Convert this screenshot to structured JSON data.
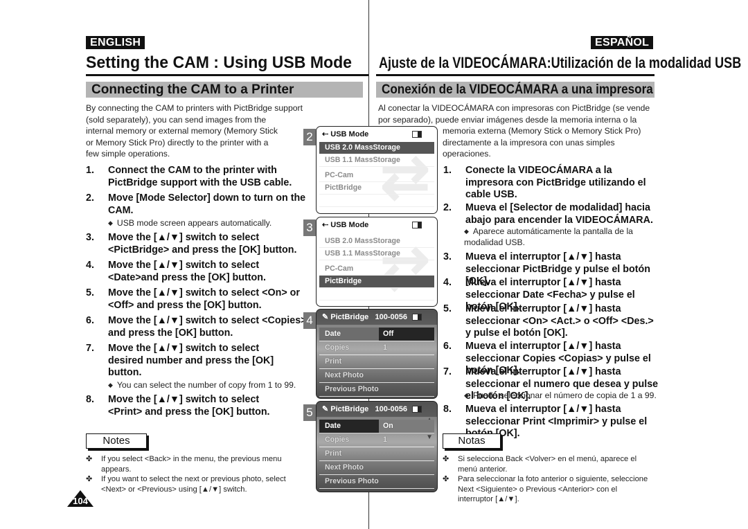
{
  "header": {
    "english_label": "ENGLISH",
    "spanish_label": "ESPAÑOL",
    "title_en": "Setting the CAM : Using USB Mode",
    "title_es": "Ajuste de la VIDEOCÁMARA:Utilización de la modalidad USB"
  },
  "section": {
    "title_en": "Connecting the CAM to a Printer",
    "title_es": "Conexión de la VIDEOCÁMARA a una impresora"
  },
  "intro": {
    "en_lines": [
      "By connecting the CAM to printers with PictBridge support",
      "(sold separately), you can send images from the",
      "internal memory or external memory (Memory Stick",
      "or Memory Stick Pro) directly to the printer with a",
      "few simple operations."
    ],
    "es_lines": [
      "Al conectar la VIDEOCÁMARA con impresoras con PictBridge (se vende",
      "por separado), puede enviar imágenes desde la memoria interna o la",
      "memoria externa (Memory Stick o Memory Stick Pro)",
      "directamente a la impresora con unas simples",
      "operaciones."
    ]
  },
  "steps_en": [
    {
      "num": "1.",
      "text": "Connect the CAM to the printer with PictBridge support with the USB cable."
    },
    {
      "num": "2.",
      "text": "Move [Mode Selector] down to turn on the CAM.",
      "bullet": "USB mode screen appears automatically."
    },
    {
      "num": "3.",
      "text": "Move the [▲/▼] switch to select <PictBridge> and press the [OK] button."
    },
    {
      "num": "4.",
      "text": "Move the [▲/▼] switch to select <Date>and press the [OK] button."
    },
    {
      "num": "5.",
      "text": "Move the [▲/▼] switch to select <On> or <Off> and press the [OK] button."
    },
    {
      "num": "6.",
      "text": "Move the [▲/▼] switch to select <Copies> and press the [OK] button."
    },
    {
      "num": "7.",
      "text": "Move the [▲/▼] switch to select desired number and press the [OK] button.",
      "bullet": "You can select the number of copy from 1 to 99."
    },
    {
      "num": "8.",
      "text": "Move the [▲/▼] switch to select <Print> and press the [OK] button."
    }
  ],
  "steps_es": [
    {
      "num": "1.",
      "text": "Conecte la VIDEOCÁMARA a la impresora con PictBridge utilizando el cable USB."
    },
    {
      "num": "2.",
      "text": "Mueva el [Selector de modalidad] hacia abajo para encender la VIDEOCÁMARA.",
      "bullet": "Aparece automáticamente la pantalla de la modalidad USB."
    },
    {
      "num": "3.",
      "text": "Mueva el interruptor [▲/▼] hasta seleccionar PictBridge y pulse el botón [OK]."
    },
    {
      "num": "4.",
      "text": "Mueva el interruptor [▲/▼] hasta seleccionar Date <Fecha> y pulse el botón [OK]."
    },
    {
      "num": "5.",
      "text": "Mueva el interruptor [▲/▼] hasta seleccionar <On> <Act.> o <Off> <Des.> y pulse el botón [OK]."
    },
    {
      "num": "6.",
      "text": "Mueva el interruptor [▲/▼] hasta seleccionar Copies <Copias> y pulse el botón [OK]."
    },
    {
      "num": "7.",
      "text": "Mueva el interruptor [▲/▼] hasta seleccionar el numero que desea y pulse el botón [OK].",
      "bullet": "Puede seleccionar el número de copia de 1 a 99."
    },
    {
      "num": "8.",
      "text": "Mueva el interruptor [▲/▼] hasta seleccionar Print <Imprimir> y pulse el botón [OK]."
    }
  ],
  "notes_en": {
    "label": "Notes",
    "items": [
      "If you select <Back> in the menu, the previous menu appears.",
      "If you want to select the next or previous photo, select <Next> or <Previous> using [▲/▼] switch."
    ]
  },
  "notes_es": {
    "label": "Notas",
    "items": [
      "Si selecciona Back <Volver> en el menú, aparece el menú anterior.",
      "Para seleccionar la foto anterior o siguiente, seleccione Next <Siguiente> o Previous <Anterior> con el interruptor [▲/▼]."
    ]
  },
  "screens": [
    {
      "num": "2",
      "title": "USB Mode",
      "icon": "usb-icon",
      "items": [
        "USB 2.0 MassStorage",
        "USB 1.1 MassStorage",
        "PC-Cam",
        "PictBridge"
      ],
      "selected": 0
    },
    {
      "num": "3",
      "title": "USB Mode",
      "icon": "usb-icon",
      "items": [
        "USB 2.0 MassStorage",
        "USB 1.1 MassStorage",
        "PC-Cam",
        "PictBridge"
      ],
      "selected": 3
    },
    {
      "num": "4",
      "title": "PictBridge",
      "file": "100-0056",
      "icon": "printer-icon",
      "rows": [
        {
          "label": "Date",
          "value": "Off"
        },
        {
          "label": "Copies",
          "value": "1"
        },
        {
          "label": "Print",
          "value": ""
        },
        {
          "label": "Next Photo",
          "value": ""
        },
        {
          "label": "Previous Photo",
          "value": ""
        }
      ]
    },
    {
      "num": "5",
      "title": "PictBridge",
      "file": "100-0056",
      "icon": "printer-icon",
      "rows": [
        {
          "label": "Date",
          "value": "On"
        },
        {
          "label": "Copies",
          "value": "1"
        },
        {
          "label": "Print",
          "value": ""
        },
        {
          "label": "Next Photo",
          "value": ""
        },
        {
          "label": "Previous Photo",
          "value": ""
        }
      ]
    }
  ],
  "page_number": "104"
}
